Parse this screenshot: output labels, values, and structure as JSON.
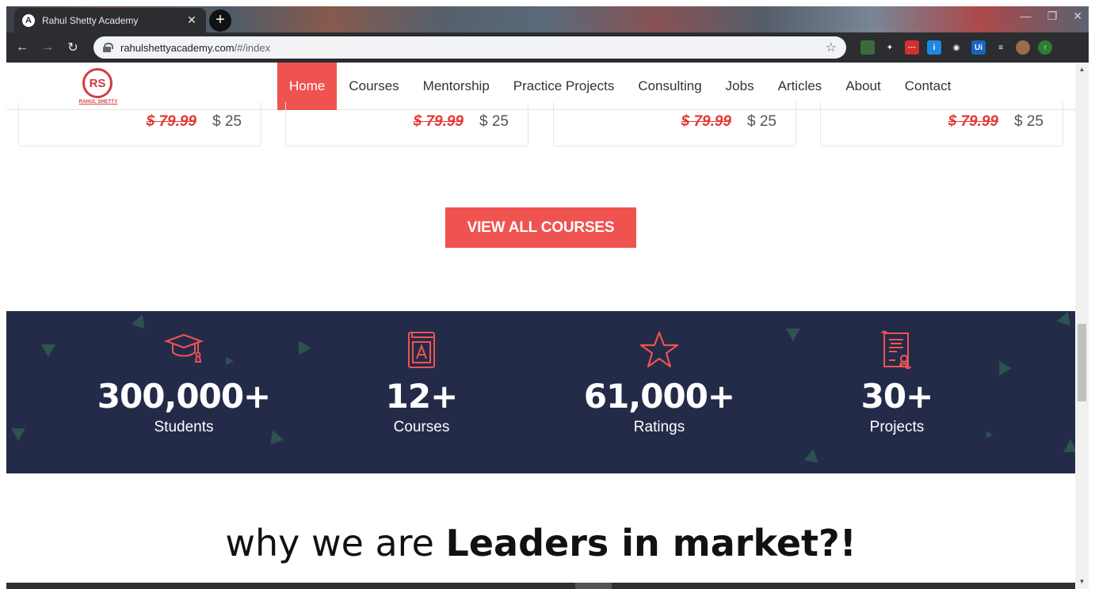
{
  "browser": {
    "tab_title": "Rahul Shetty Academy",
    "tab_favicon_letter": "A",
    "tab_close": "✕",
    "new_tab": "+",
    "url_host": "rahulshettyacademy.com",
    "url_path": "/#/index",
    "window_controls": [
      "—",
      "❐",
      "✕"
    ],
    "extensions": [
      {
        "name": "tree-extension",
        "label": "",
        "color": "#3a6b3a"
      },
      {
        "name": "pin-extension",
        "label": "✦",
        "color": "#2b2d31"
      },
      {
        "name": "red-extension",
        "label": "···",
        "color": "#d32f2f"
      },
      {
        "name": "info-extension",
        "label": "i",
        "color": "#1e88e5"
      },
      {
        "name": "camera-extension",
        "label": "◉",
        "color": "#2b2d31"
      },
      {
        "name": "uipath-extension",
        "label": "Ui",
        "color": "#1565c0"
      },
      {
        "name": "playlist-extension",
        "label": "≡",
        "color": "#2b2d31"
      },
      {
        "name": "profile-avatar",
        "label": "",
        "color": "#9c6b4a"
      },
      {
        "name": "update-extension",
        "label": "↑",
        "color": "#2e7d32"
      }
    ]
  },
  "site": {
    "logo_initials": "RS",
    "logo_brand": "RAHUL SHETTY",
    "menu": [
      {
        "label": "Home",
        "active": true
      },
      {
        "label": "Courses",
        "active": false
      },
      {
        "label": "Mentorship",
        "active": false
      },
      {
        "label": "Practice Projects",
        "active": false
      },
      {
        "label": "Consulting",
        "active": false
      },
      {
        "label": "Jobs",
        "active": false
      },
      {
        "label": "Articles",
        "active": false
      },
      {
        "label": "About",
        "active": false
      },
      {
        "label": "Contact",
        "active": false
      }
    ],
    "cards": [
      {
        "old_price": "$ 79.99",
        "new_price": "$ 25"
      },
      {
        "old_price": "$ 79.99",
        "new_price": "$ 25"
      },
      {
        "old_price": "$ 79.99",
        "new_price": "$ 25"
      },
      {
        "old_price": "$ 79.99",
        "new_price": "$ 25"
      }
    ],
    "cta_label": "VIEW ALL COURSES",
    "stats": [
      {
        "value": "300,000+",
        "label": "Students",
        "icon": "graduation-cap-icon"
      },
      {
        "value": "12+",
        "label": "Courses",
        "icon": "book-icon"
      },
      {
        "value": "61,000+",
        "label": "Ratings",
        "icon": "star-icon"
      },
      {
        "value": "30+",
        "label": "Projects",
        "icon": "certificate-icon"
      }
    ],
    "headline_light": "why we are ",
    "headline_bold": "Leaders in market?!"
  },
  "colors": {
    "accent": "#ef5350",
    "stats_bg": "#232b49",
    "old_price": "#e53935"
  }
}
